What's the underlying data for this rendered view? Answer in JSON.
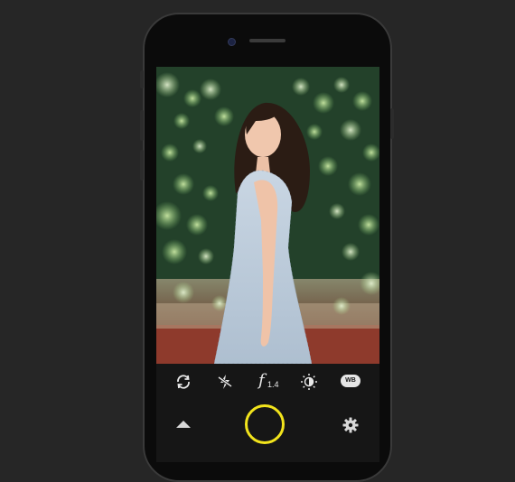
{
  "camera_app": {
    "controls": {
      "aperture_symbol": "f",
      "aperture_value": "1.4",
      "white_balance_label": "WB"
    },
    "icons": {
      "switch_camera": "refresh-cycle-icon",
      "flash_off": "flash-off-icon",
      "exposure": "sun-half-icon",
      "menu_up": "chevron-up-icon",
      "settings": "gear-icon"
    },
    "colors": {
      "shutter_ring": "#f2e41c",
      "controls_background": "#161616",
      "page_background": "#262626"
    }
  }
}
